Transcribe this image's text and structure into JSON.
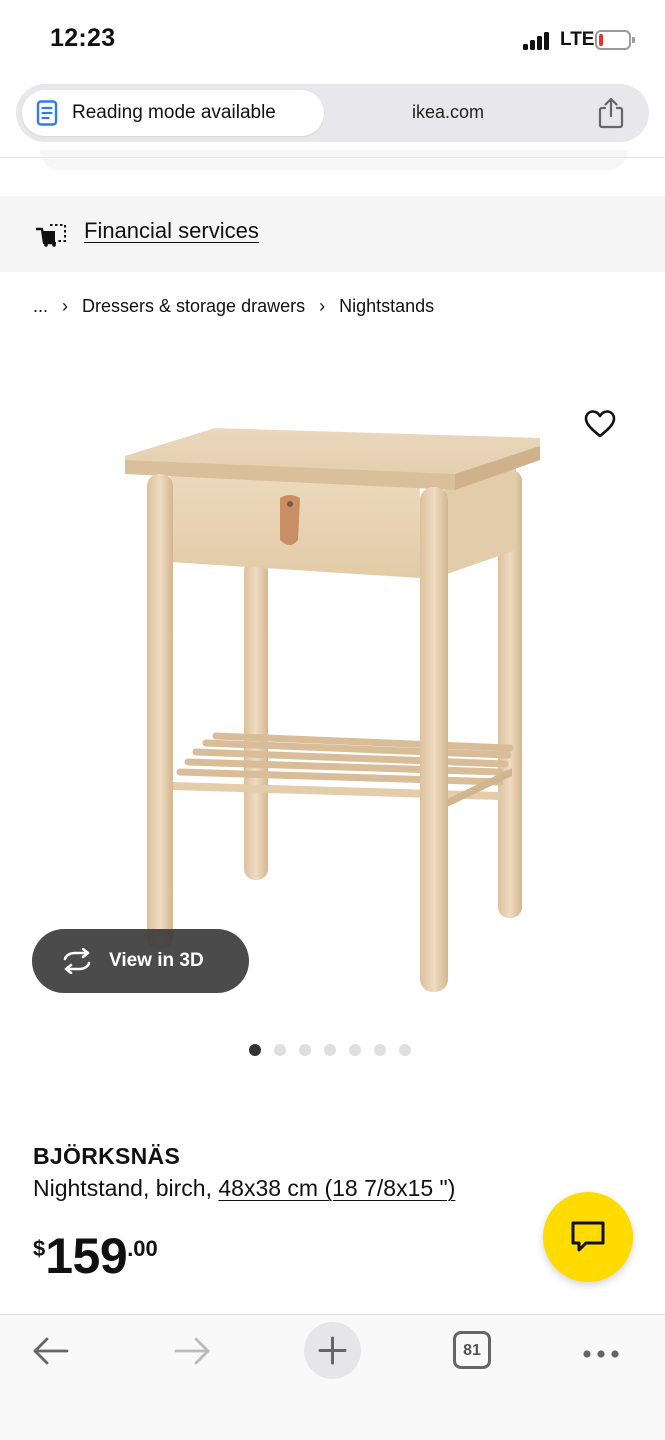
{
  "status_bar": {
    "time": "12:23",
    "network": "LTE",
    "battery_level": 0.15,
    "battery_color": "#e8332c"
  },
  "url_bar": {
    "reading_mode_label": "Reading mode available",
    "domain": "ikea.com",
    "icons": [
      "reading-mode-icon",
      "share-icon"
    ]
  },
  "financial": {
    "label": "Financial services",
    "icon": "shopping-cart-icon"
  },
  "breadcrumb": {
    "items": [
      "...",
      "Dressers & storage drawers",
      "Nightstands"
    ],
    "separator": "›"
  },
  "gallery": {
    "view_3d_label": "View in 3D",
    "dot_count": 7,
    "active_index": 0,
    "favorite_icon": "heart-outline-icon"
  },
  "product": {
    "brand": "BJÖRKSNÄS",
    "description": "Nightstand, birch, ",
    "measure": "48x38 cm (18 7/8x15 \")",
    "price_currency": "$",
    "price_int": "159",
    "price_dec": ".00",
    "chat_icon": "chat-bubble-icon",
    "accent_color": "#ffdb00"
  },
  "toolbar": {
    "tab_count": "81",
    "icons": [
      "back-arrow-icon",
      "forward-arrow-icon",
      "plus-icon",
      "tabs-icon",
      "more-icon"
    ]
  }
}
